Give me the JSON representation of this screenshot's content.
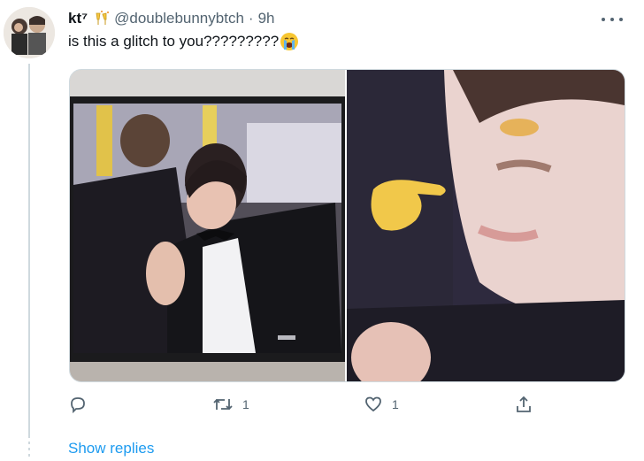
{
  "tweet": {
    "display_name": "kt⁷",
    "handle": "@doublebunnybtch",
    "separator": "·",
    "time": "9h",
    "text": "is this a glitch to you?????????",
    "emoji_icon": "crying-face-emoji-icon",
    "badge_icon": "clinking-glasses-icon"
  },
  "media": {
    "left_image": "photo-tv-screen-with-dancer",
    "right_image": "photo-zoomed-face-with-pointing-hand"
  },
  "actions": {
    "reply": {
      "icon": "reply-icon",
      "count": ""
    },
    "retweet": {
      "icon": "retweet-icon",
      "count": "1"
    },
    "like": {
      "icon": "heart-icon",
      "count": "1"
    },
    "share": {
      "icon": "share-icon"
    }
  },
  "thread": {
    "show_replies_label": "Show replies"
  },
  "colors": {
    "accent": "#1d9bf0",
    "secondary_text": "#536471",
    "border": "#cfd9de"
  }
}
